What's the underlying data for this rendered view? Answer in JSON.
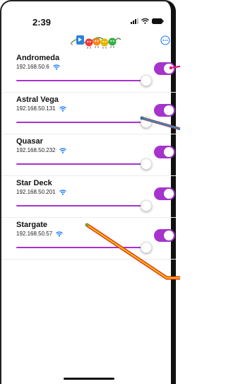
{
  "status_bar": {
    "time": "2:39",
    "icons": [
      "cellular-signal-icon",
      "wifi-icon",
      "battery-icon"
    ]
  },
  "app_header": {
    "logo": "led-string-logo",
    "more_icon": "ellipsis-circle-icon"
  },
  "colors": {
    "accent": "#a633cc",
    "wifi": "#1a7cf5"
  },
  "devices": [
    {
      "name": "Andromeda",
      "ip": "192.168.50.6",
      "on": true,
      "brightness": 0.97
    },
    {
      "name": "Astral Vega",
      "ip": "192.168.50.131",
      "on": true,
      "brightness": 0.97
    },
    {
      "name": "Quasar",
      "ip": "192.168.50.232",
      "on": true,
      "brightness": 0.97
    },
    {
      "name": "Star Deck",
      "ip": "192.168.50.201",
      "on": true,
      "brightness": 0.97
    },
    {
      "name": "Stargate",
      "ip": "192.168.50.57",
      "on": true,
      "brightness": 0.97
    }
  ]
}
